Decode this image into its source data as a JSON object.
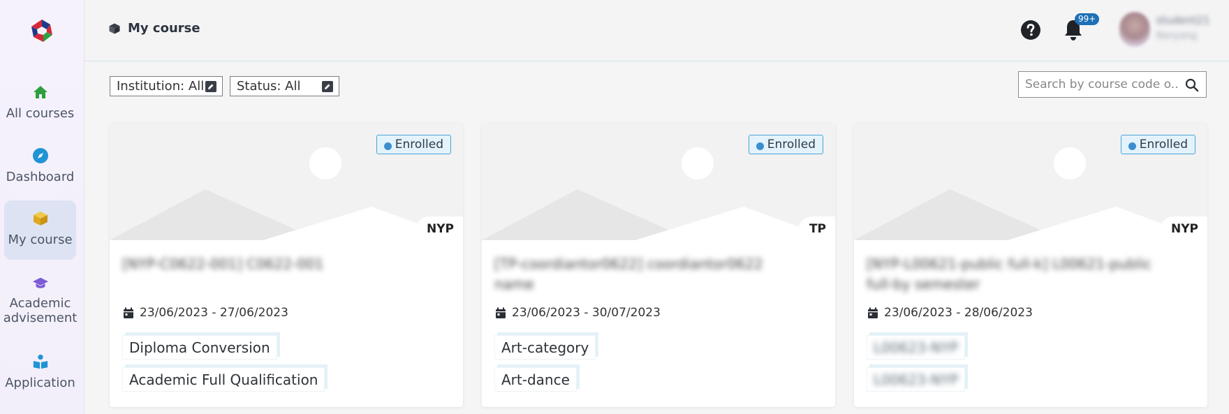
{
  "sidebar": {
    "items": [
      {
        "label": "All courses",
        "icon": "home-icon",
        "color": "#2e9e3e"
      },
      {
        "label": "Dashboard",
        "icon": "compass-icon",
        "color": "#1f94d6"
      },
      {
        "label": "My course",
        "icon": "cube-icon",
        "color": "#e0b02a",
        "active": true
      },
      {
        "label": "Academic advisement",
        "icon": "graduation-cap-icon",
        "color": "#7b5bd6"
      },
      {
        "label": "Application",
        "icon": "book-reader-icon",
        "color": "#1f94d6"
      }
    ]
  },
  "header": {
    "title": "My course",
    "notification_count": "99+",
    "user_name": "student21",
    "user_sub": "Nanyang"
  },
  "filters": {
    "institution": "Institution: All",
    "status": "Status: All"
  },
  "search": {
    "placeholder": "Search by course code o..."
  },
  "courses": [
    {
      "status": "Enrolled",
      "institution": "NYP",
      "title": "[NYP-C0622-001] C0622-001",
      "date": "23/06/2023 - 27/06/2023",
      "tags": [
        "Diploma Conversion",
        "Academic Full Qualification"
      ]
    },
    {
      "status": "Enrolled",
      "institution": "TP",
      "title": "[TP-coordiantor0622] coordiantor0622 name",
      "date": "23/06/2023 - 30/07/2023",
      "tags": [
        "Art-category",
        "Art-dance"
      ]
    },
    {
      "status": "Enrolled",
      "institution": "NYP",
      "title": "[NYP-L00621-public full-k] L00621-public full-by semester",
      "date": "23/06/2023 - 28/06/2023",
      "tags": [
        "L00623-NYP",
        "L00623-NYP"
      ]
    }
  ],
  "colors": {
    "accent": "#1e6fb5",
    "enrolled_badge": "#4aa3d6",
    "sidebar_active": "#dde3f2"
  }
}
